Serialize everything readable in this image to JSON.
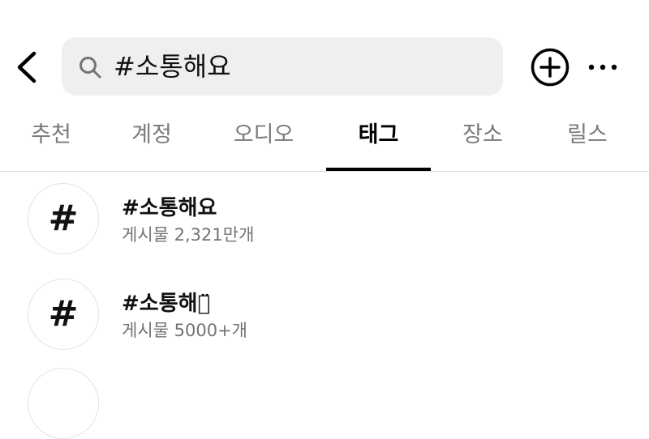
{
  "search": {
    "query": "#소통해요",
    "icon": "search-icon"
  },
  "header": {
    "back_icon": "chevron-left-icon",
    "add_icon": "plus-circle-icon",
    "more_icon": "ellipsis-icon"
  },
  "tabs": [
    {
      "label": "추천",
      "active": false
    },
    {
      "label": "계정",
      "active": false
    },
    {
      "label": "오디오",
      "active": false
    },
    {
      "label": "태그",
      "active": true
    },
    {
      "label": "장소",
      "active": false
    },
    {
      "label": "릴스",
      "active": false
    }
  ],
  "results": [
    {
      "icon": "#",
      "title": "#소통해요",
      "subtitle": "게시물 2,321만개"
    },
    {
      "icon": "#",
      "title": "#소통해요̈",
      "subtitle": "게시물 5000+개"
    }
  ],
  "colors": {
    "search_bg": "#efefef",
    "inactive_tab": "#7a7a7a",
    "subtitle": "#737373",
    "divider": "#dbdbdb"
  }
}
